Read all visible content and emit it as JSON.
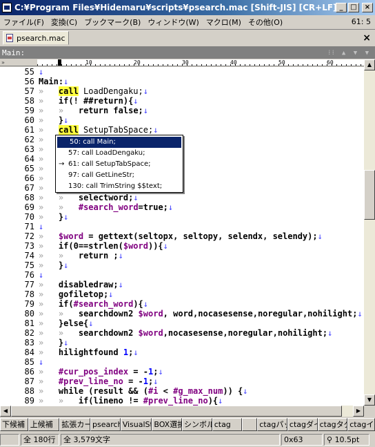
{
  "window": {
    "title": "C:¥Program Files¥Hidemaru¥scripts¥psearch.mac  [Shift-JIS] [CR+LF] -",
    "buttons": [
      "_",
      "□",
      "×"
    ]
  },
  "menu": {
    "items": [
      "ファイル(F)",
      "変換(C)",
      "ブックマーク(B)",
      "ウィンドウ(W)",
      "マクロ(M)",
      "その他(O)"
    ],
    "cursor_position": "61: 5"
  },
  "tab": {
    "label": "psearch.mac",
    "close": "×"
  },
  "header": {
    "label": "Main:",
    "icons": "⁞⁞ ▲ ▼ ▼"
  },
  "ruler": {
    "marker": "»",
    "ticks": [
      "10",
      "20",
      "30",
      "40",
      "50",
      "60"
    ]
  },
  "editor": {
    "lines": [
      {
        "n": "55",
        "parts": [
          {
            "t": "↓",
            "c": "nl"
          }
        ]
      },
      {
        "n": "56",
        "parts": [
          {
            "t": "Main:"
          },
          {
            "t": "↓",
            "c": "nl"
          }
        ]
      },
      {
        "n": "57",
        "parts": [
          {
            "t": "»",
            "c": "tab"
          },
          {
            "t": "   "
          },
          {
            "t": "call",
            "c": "kw"
          },
          {
            "t": " LoadDengaku;",
            "c": "n"
          },
          {
            "t": "↓",
            "c": "nl"
          }
        ]
      },
      {
        "n": "58",
        "parts": [
          {
            "t": "»",
            "c": "tab"
          },
          {
            "t": "   "
          },
          {
            "t": "if(! ##return){"
          },
          {
            "t": "↓",
            "c": "nl"
          }
        ]
      },
      {
        "n": "59",
        "parts": [
          {
            "t": "»",
            "c": "tab"
          },
          {
            "t": "   "
          },
          {
            "t": "»",
            "c": "tab"
          },
          {
            "t": "   "
          },
          {
            "t": "return false;"
          },
          {
            "t": "↓",
            "c": "nl"
          }
        ]
      },
      {
        "n": "60",
        "parts": [
          {
            "t": "»",
            "c": "tab"
          },
          {
            "t": "   "
          },
          {
            "t": "}"
          },
          {
            "t": "↓",
            "c": "nl"
          }
        ]
      },
      {
        "n": "61",
        "parts": [
          {
            "t": "»",
            "c": "tab"
          },
          {
            "t": "   "
          },
          {
            "t": "call",
            "c": "kw"
          },
          {
            "t": " SetupTabSpace;",
            "c": "n"
          },
          {
            "t": "↓",
            "c": "nl"
          }
        ]
      },
      {
        "n": "62",
        "parts": [
          {
            "t": "»",
            "c": "tab"
          }
        ]
      },
      {
        "n": "63",
        "parts": [
          {
            "t": "»",
            "c": "tab"
          }
        ]
      },
      {
        "n": "64",
        "parts": [
          {
            "t": "»",
            "c": "tab"
          }
        ]
      },
      {
        "n": "65",
        "parts": [
          {
            "t": "»",
            "c": "tab"
          }
        ]
      },
      {
        "n": "66",
        "parts": [
          {
            "t": "»",
            "c": "tab"
          }
        ]
      },
      {
        "n": "67",
        "parts": [
          {
            "t": "»",
            "c": "tab"
          }
        ]
      },
      {
        "n": "68",
        "parts": [
          {
            "t": "»",
            "c": "tab"
          },
          {
            "t": "   "
          },
          {
            "t": "»",
            "c": "tab"
          },
          {
            "t": "   "
          },
          {
            "t": "selectword;"
          },
          {
            "t": "↓",
            "c": "nl"
          }
        ]
      },
      {
        "n": "69",
        "parts": [
          {
            "t": "»",
            "c": "tab"
          },
          {
            "t": "   "
          },
          {
            "t": "»",
            "c": "tab"
          },
          {
            "t": "   "
          },
          {
            "t": "#search_word",
            "c": "var"
          },
          {
            "t": "=true;"
          },
          {
            "t": "↓",
            "c": "nl"
          }
        ]
      },
      {
        "n": "70",
        "parts": [
          {
            "t": "»",
            "c": "tab"
          },
          {
            "t": "   "
          },
          {
            "t": "}"
          },
          {
            "t": "↓",
            "c": "nl"
          }
        ]
      },
      {
        "n": "71",
        "parts": [
          {
            "t": "↓",
            "c": "nl"
          }
        ]
      },
      {
        "n": "72",
        "parts": [
          {
            "t": "»",
            "c": "tab"
          },
          {
            "t": "   "
          },
          {
            "t": "$word",
            "c": "var"
          },
          {
            "t": " = gettext(seltopx, seltopy, selendx, selendy);"
          },
          {
            "t": "↓",
            "c": "nl"
          }
        ]
      },
      {
        "n": "73",
        "parts": [
          {
            "t": "»",
            "c": "tab"
          },
          {
            "t": "   "
          },
          {
            "t": "if(0==strlen("
          },
          {
            "t": "$word",
            "c": "var"
          },
          {
            "t": ")){"
          },
          {
            "t": "↓",
            "c": "nl"
          }
        ]
      },
      {
        "n": "74",
        "parts": [
          {
            "t": "»",
            "c": "tab"
          },
          {
            "t": "   "
          },
          {
            "t": "»",
            "c": "tab"
          },
          {
            "t": "   "
          },
          {
            "t": "return ;"
          },
          {
            "t": "↓",
            "c": "nl"
          }
        ]
      },
      {
        "n": "75",
        "parts": [
          {
            "t": "»",
            "c": "tab"
          },
          {
            "t": "   "
          },
          {
            "t": "}"
          },
          {
            "t": "↓",
            "c": "nl"
          }
        ]
      },
      {
        "n": "76",
        "parts": [
          {
            "t": "↓",
            "c": "nl"
          }
        ]
      },
      {
        "n": "77",
        "parts": [
          {
            "t": "»",
            "c": "tab"
          },
          {
            "t": "   "
          },
          {
            "t": "disabledraw;"
          },
          {
            "t": "↓",
            "c": "nl"
          }
        ]
      },
      {
        "n": "78",
        "parts": [
          {
            "t": "»",
            "c": "tab"
          },
          {
            "t": "   "
          },
          {
            "t": "gofiletop;"
          },
          {
            "t": "↓",
            "c": "nl"
          }
        ]
      },
      {
        "n": "79",
        "parts": [
          {
            "t": "»",
            "c": "tab"
          },
          {
            "t": "   "
          },
          {
            "t": "if("
          },
          {
            "t": "#search_word",
            "c": "var"
          },
          {
            "t": "){"
          },
          {
            "t": "↓",
            "c": "nl"
          }
        ]
      },
      {
        "n": "80",
        "parts": [
          {
            "t": "»",
            "c": "tab"
          },
          {
            "t": "   "
          },
          {
            "t": "»",
            "c": "tab"
          },
          {
            "t": "   "
          },
          {
            "t": "searchdown2 "
          },
          {
            "t": "$word",
            "c": "var"
          },
          {
            "t": ", word,nocasesense,noregular,nohilight;"
          },
          {
            "t": "↓",
            "c": "nl"
          }
        ]
      },
      {
        "n": "81",
        "parts": [
          {
            "t": "»",
            "c": "tab"
          },
          {
            "t": "   "
          },
          {
            "t": "}else{"
          },
          {
            "t": "↓",
            "c": "nl"
          }
        ]
      },
      {
        "n": "82",
        "parts": [
          {
            "t": "»",
            "c": "tab"
          },
          {
            "t": "   "
          },
          {
            "t": "»",
            "c": "tab"
          },
          {
            "t": "   "
          },
          {
            "t": "searchdown2 "
          },
          {
            "t": "$word",
            "c": "var"
          },
          {
            "t": ",nocasesense,noregular,nohilight;"
          },
          {
            "t": "↓",
            "c": "nl"
          }
        ]
      },
      {
        "n": "83",
        "parts": [
          {
            "t": "»",
            "c": "tab"
          },
          {
            "t": "   "
          },
          {
            "t": "}"
          },
          {
            "t": "↓",
            "c": "nl"
          }
        ]
      },
      {
        "n": "84",
        "parts": [
          {
            "t": "»",
            "c": "tab"
          },
          {
            "t": "   "
          },
          {
            "t": "hilightfound "
          },
          {
            "t": "1",
            "c": "num"
          },
          {
            "t": ";"
          },
          {
            "t": "↓",
            "c": "nl"
          }
        ]
      },
      {
        "n": "85",
        "parts": [
          {
            "t": "↓",
            "c": "nl"
          }
        ]
      },
      {
        "n": "86",
        "parts": [
          {
            "t": "»",
            "c": "tab"
          },
          {
            "t": "   "
          },
          {
            "t": "#cur_pos_index",
            "c": "var"
          },
          {
            "t": " = -"
          },
          {
            "t": "1",
            "c": "num"
          },
          {
            "t": ";"
          },
          {
            "t": "↓",
            "c": "nl"
          }
        ]
      },
      {
        "n": "87",
        "parts": [
          {
            "t": "»",
            "c": "tab"
          },
          {
            "t": "   "
          },
          {
            "t": "#prev_line_no",
            "c": "var"
          },
          {
            "t": " = -"
          },
          {
            "t": "1",
            "c": "num"
          },
          {
            "t": ";"
          },
          {
            "t": "↓",
            "c": "nl"
          }
        ]
      },
      {
        "n": "88",
        "parts": [
          {
            "t": "»",
            "c": "tab"
          },
          {
            "t": "   "
          },
          {
            "t": "while (result && ("
          },
          {
            "t": "#i",
            "c": "var"
          },
          {
            "t": " < "
          },
          {
            "t": "#g_max_num",
            "c": "var"
          },
          {
            "t": ")) {"
          },
          {
            "t": "↓",
            "c": "nl"
          }
        ]
      },
      {
        "n": "89",
        "parts": [
          {
            "t": "»",
            "c": "tab"
          },
          {
            "t": "   "
          },
          {
            "t": "»",
            "c": "tab"
          },
          {
            "t": "   "
          },
          {
            "t": "if(lineno != "
          },
          {
            "t": "#prev_line_no",
            "c": "var"
          },
          {
            "t": "){"
          },
          {
            "t": "↓",
            "c": "nl"
          }
        ]
      }
    ]
  },
  "popup": {
    "items": [
      {
        "arrow": "",
        "label": "50: call Main;",
        "selected": true
      },
      {
        "arrow": "",
        "label": "57: call LoadDengaku;",
        "selected": false
      },
      {
        "arrow": "→",
        "label": "61: call SetupTabSpace;",
        "selected": false
      },
      {
        "arrow": "",
        "label": "97: call GetLineStr;",
        "selected": false
      },
      {
        "arrow": "",
        "label": "130: call TrimString $$text;",
        "selected": false
      }
    ]
  },
  "function_keys": [
    "下候補",
    "上候補",
    "拡張カー",
    "psearch",
    "VisualSt",
    "BOX選択",
    "シンボルコ",
    "ctag",
    "",
    "ctagパッ",
    "ctagダイ",
    "ctagタグ",
    "ctagインプ"
  ],
  "status": {
    "lines": "全 180行",
    "chars": "全 3,579文字",
    "code": "0x63",
    "zoom": "10.5pt"
  }
}
